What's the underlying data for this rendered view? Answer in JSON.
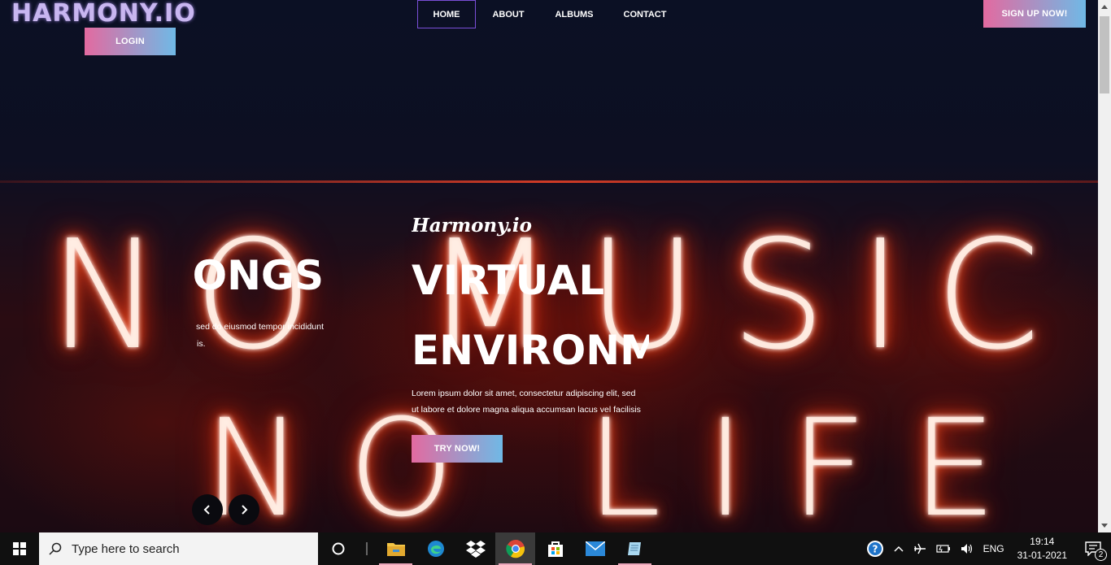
{
  "header": {
    "logo": "HARMONY.IO",
    "login_label": "LOGIN",
    "signup_label": "SIGN UP NOW!",
    "nav": [
      {
        "label": "HOME",
        "active": true
      },
      {
        "label": "ABOUT"
      },
      {
        "label": "ALBUMS"
      },
      {
        "label": "CONTACT"
      }
    ]
  },
  "background": {
    "neon_line1": "NO MUSIC",
    "neon_line2": "NO LIFE"
  },
  "slide_left": {
    "heading": "...EE SONGS",
    "para_line1": "sed do eiusmod tempor incididunt",
    "para_line2": "is."
  },
  "slide_main": {
    "script_title": "Harmony.io",
    "heading_line1": "VIRTUAL",
    "heading_line2": "ENVIRONMENT",
    "para_line1": "Lorem ipsum dolor sit amet, consectetur adipiscing elit, sed",
    "para_line2": "ut labore et dolore magna aliqua accumsan lacus vel facilisis",
    "cta_label": "TRY NOW!"
  },
  "taskbar": {
    "search_placeholder": "Type here to search",
    "language": "ENG",
    "time": "19:14",
    "date": "31-01-2021",
    "notification_count": "2"
  },
  "colors": {
    "accent_pink": "#e36aa0",
    "accent_blue": "#6fb9e6",
    "nav_active_border": "#7a4fd8",
    "page_bg": "#0b1024"
  }
}
